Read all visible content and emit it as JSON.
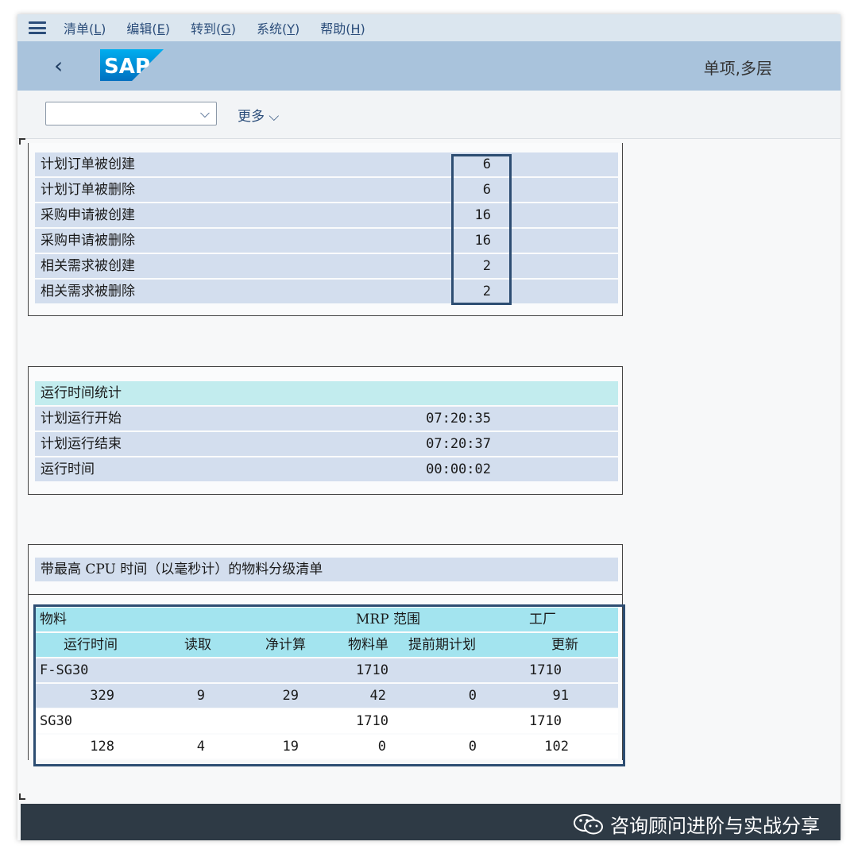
{
  "menu": {
    "items": [
      {
        "text": "清单(",
        "key": "L",
        "close": ")"
      },
      {
        "text": "编辑(",
        "key": "E",
        "close": ")"
      },
      {
        "text": "转到(",
        "key": "G",
        "close": ")"
      },
      {
        "text": "系统(",
        "key": "Y",
        "close": ")"
      },
      {
        "text": "帮助(",
        "key": "H",
        "close": ")"
      }
    ]
  },
  "header": {
    "back_icon": "chevron-left-icon",
    "logo_text": "SAP",
    "title": "单项,多层"
  },
  "toolbar": {
    "combo_value": "",
    "more_label": "更多"
  },
  "summary": {
    "rows": [
      {
        "label": "计划订单被创建",
        "value": "6"
      },
      {
        "label": "计划订单被删除",
        "value": "6"
      },
      {
        "label": "采购申请被创建",
        "value": "16"
      },
      {
        "label": "采购申请被删除",
        "value": "16"
      },
      {
        "label": "相关需求被创建",
        "value": "2"
      },
      {
        "label": "相关需求被删除",
        "value": "2"
      }
    ]
  },
  "runtime": {
    "header": "运行时间统计",
    "rows": [
      {
        "label": "计划运行开始",
        "value": "07:20:35"
      },
      {
        "label": "计划运行结束",
        "value": "07:20:37"
      },
      {
        "label": "运行时间",
        "value": "00:00:02"
      }
    ]
  },
  "cpu": {
    "title": "带最高 CPU 时间（以毫秒计）的物料分级清单",
    "header1": {
      "material": "物料",
      "mrp_area": "MRP 范围",
      "plant": "工厂"
    },
    "header2": {
      "runtime": "运行时间",
      "read": "读取",
      "net_calc": "净计算",
      "bom": "物料单",
      "lead_plan": "提前期计划",
      "update": "更新"
    },
    "materials": [
      {
        "material": "F-SG30",
        "mrp_area": "1710",
        "plant": "1710",
        "runtime": "329",
        "read": "9",
        "net_calc": "29",
        "bom": "42",
        "lead_plan": "0",
        "update": "91"
      },
      {
        "material": "SG30",
        "mrp_area": "1710",
        "plant": "1710",
        "runtime": "128",
        "read": "4",
        "net_calc": "19",
        "bom": "0",
        "lead_plan": "0",
        "update": "102"
      }
    ]
  },
  "watermark": "咨询顾问进阶与实战分享",
  "colors": {
    "menubar": "#dbe6ef",
    "titlebar": "#a9c3dc",
    "row": "#d3deee",
    "header_teal": "#c2ecee",
    "header_cyan": "#a3e4ef",
    "highlight": "#2d4d72",
    "footer": "#2e3a45"
  }
}
